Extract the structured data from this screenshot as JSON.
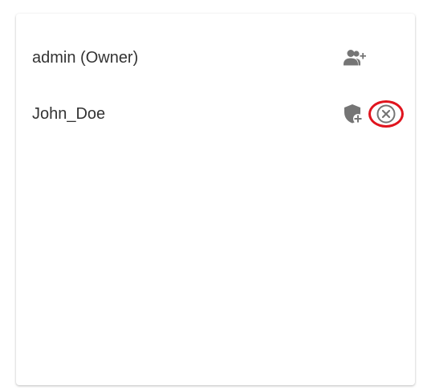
{
  "members": [
    {
      "name": "admin (Owner)",
      "actions": [
        {
          "icon": "add-person-icon",
          "tooltip": ""
        }
      ]
    },
    {
      "name": "John_Doe",
      "actions": [
        {
          "icon": "add-admin-shield-icon",
          "tooltip": ""
        },
        {
          "icon": "remove-circle-x-icon",
          "tooltip": "",
          "highlighted": true
        }
      ]
    }
  ],
  "colors": {
    "icon": "#757575",
    "text": "#333333",
    "highlight": "#e0141e"
  }
}
